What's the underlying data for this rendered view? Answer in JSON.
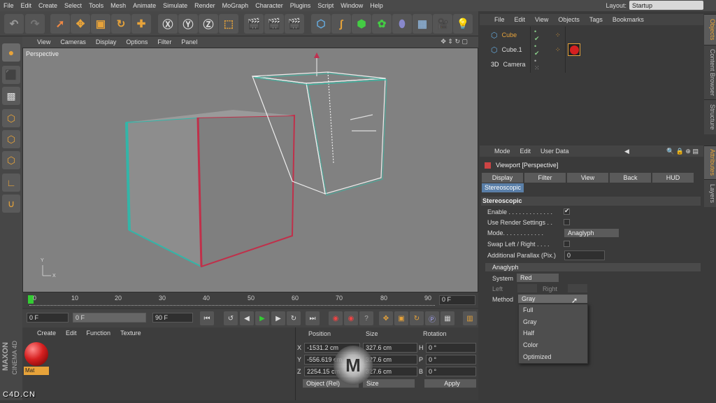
{
  "menu": [
    "File",
    "Edit",
    "Create",
    "Select",
    "Tools",
    "Mesh",
    "Animate",
    "Simulate",
    "Render",
    "MoGraph",
    "Character",
    "Plugins",
    "Script",
    "Window",
    "Help"
  ],
  "layout": {
    "label": "Layout:",
    "value": "Startup"
  },
  "viewport": {
    "menu": [
      "View",
      "Cameras",
      "Display",
      "Options",
      "Filter",
      "Panel"
    ],
    "label": "Perspective",
    "axis_y": "Y",
    "axis_x": "X"
  },
  "timeline": {
    "ticks": [
      "0",
      "10",
      "20",
      "30",
      "40",
      "50",
      "60",
      "70",
      "80",
      "90"
    ],
    "frame": "0 F"
  },
  "playback": {
    "start": "0 F",
    "range_start": "0 F",
    "range_end": "90 F",
    "end": "90 F"
  },
  "materials": {
    "menu": [
      "Create",
      "Edit",
      "Function",
      "Texture"
    ],
    "mat_name": "Mat",
    "brand1": "MAXON",
    "brand2": "CINEMA 4D"
  },
  "coords": {
    "headers": [
      "Position",
      "Size",
      "Rotation"
    ],
    "rows": [
      {
        "axis": "X",
        "pos": "-1531.2 cm",
        "size": "327.6 cm",
        "rl": "H",
        "rot": "0 °"
      },
      {
        "axis": "Y",
        "pos": "-556.619 cm",
        "size": "327.6 cm",
        "rl": "P",
        "rot": "0 °"
      },
      {
        "axis": "Z",
        "pos": "2254.15 cm",
        "size": "327.6 cm",
        "rl": "B",
        "rot": "0 °"
      }
    ],
    "mode": "Object (Rel)",
    "size_mode": "Size",
    "apply": "Apply"
  },
  "objects": {
    "menu": [
      "File",
      "Edit",
      "View",
      "Objects",
      "Tags",
      "Bookmarks"
    ],
    "items": [
      "Cube",
      "Cube.1",
      "Camera"
    ]
  },
  "attributes": {
    "menu": [
      "Mode",
      "Edit",
      "User Data"
    ],
    "title": "Viewport [Perspective]",
    "tabs": [
      "Display",
      "Filter",
      "View",
      "Back",
      "HUD"
    ],
    "active_tab": "Stereoscopic",
    "section": "Stereoscopic",
    "props": [
      {
        "label": "Enable . . . . . . . . . . . . .",
        "value": ""
      },
      {
        "label": "Use Render Settings . .",
        "value": ""
      },
      {
        "label": "Mode. . . . . . . . . . . .",
        "value": "Anaglyph"
      },
      {
        "label": "Swap Left / Right . . . .",
        "value": ""
      },
      {
        "label": "Additional Parallax (Pix.)",
        "value": "0"
      }
    ],
    "subsection": "Anaglyph",
    "system_label": "System",
    "system_value": "Red",
    "left": "Left",
    "right": "Right",
    "method_label": "Method",
    "method_value": "Gray"
  },
  "popup": [
    "Full",
    "Gray",
    "Half",
    "Color",
    "Optimized"
  ],
  "side_tabs": [
    "Objects",
    "Content Browser",
    "Structure",
    "Attributes",
    "Layers"
  ],
  "watermark": "C4D.CN",
  "colors": {
    "accent": "#e7a33a",
    "selected_obj": "#e7a33a",
    "material": "#d62020"
  }
}
